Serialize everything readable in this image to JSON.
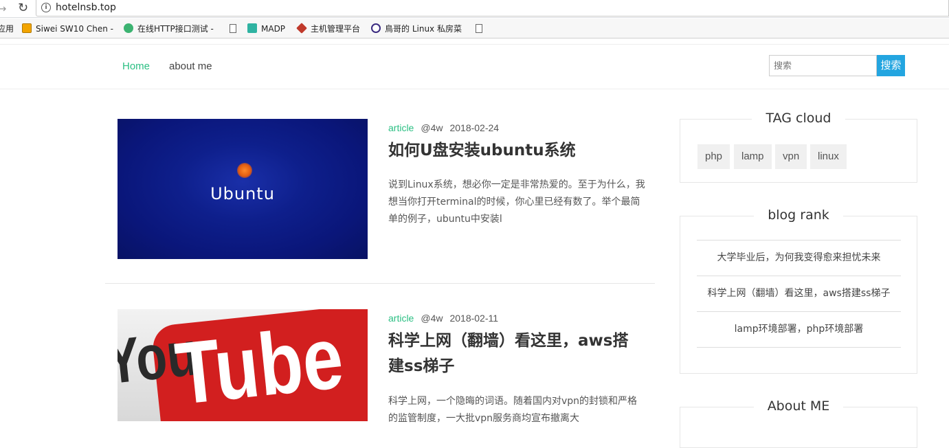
{
  "browser": {
    "url": "hotelnsb.top",
    "bookmarks": [
      {
        "label": "应用",
        "icon": "apps-icon",
        "color": "#ffffff"
      },
      {
        "label": "Siwei SW10 Chen -",
        "icon": "siwei-icon",
        "color": "#f2a400"
      },
      {
        "label": "在线HTTP接口测试 -",
        "icon": "gear-icon",
        "color": "#3cb371"
      },
      {
        "label": "",
        "icon": "page-icon",
        "color": "#666666"
      },
      {
        "label": "MADP",
        "icon": "madp-icon",
        "color": "#2fb3a2"
      },
      {
        "label": "主机管理平台",
        "icon": "host-icon",
        "color": "#c0392b"
      },
      {
        "label": "鳥哥的 Linux 私房菜",
        "icon": "linux-icon",
        "color": "#3a2a80"
      },
      {
        "label": "",
        "icon": "page-icon",
        "color": "#666666"
      }
    ]
  },
  "header": {
    "nav": [
      {
        "label": "Home",
        "active": true
      },
      {
        "label": "about me",
        "active": false
      }
    ],
    "search": {
      "placeholder": "搜索",
      "button": "搜索"
    }
  },
  "posts": [
    {
      "category": "article",
      "author": "@4w",
      "date": "2018-02-24",
      "title": "如何U盘安装ubuntu系统",
      "excerpt": "说到Linux系统，想必你一定是非常热爱的。至于为什么，我想当你打开terminal的时候，你心里已经有数了。举个最简单的例子，ubuntu中安装l",
      "thumb_text": "Ubuntu"
    },
    {
      "category": "article",
      "author": "@4w",
      "date": "2018-02-11",
      "title": "科学上网（翻墙）看这里，aws搭建ss梯子",
      "excerpt": "科学上网，一个隐晦的词语。随着国内对vpn的封锁和严格的监管制度，一大批vpn服务商均宣布撤离大",
      "thumb_text_1": "You",
      "thumb_text_2": "Tube"
    }
  ],
  "sidebar": {
    "tag_cloud": {
      "title": "TAG cloud",
      "tags": [
        "php",
        "lamp",
        "vpn",
        "linux"
      ]
    },
    "blog_rank": {
      "title": "blog rank",
      "items": [
        "大学毕业后，为何我变得愈来担忧未来",
        "科学上网（翻墙）看这里，aws搭建ss梯子",
        "lamp环境部署，php环境部署"
      ]
    },
    "about_me": {
      "title": "About ME"
    }
  },
  "colors": {
    "accent": "#2bbf83",
    "search_button": "#23a5e0"
  }
}
